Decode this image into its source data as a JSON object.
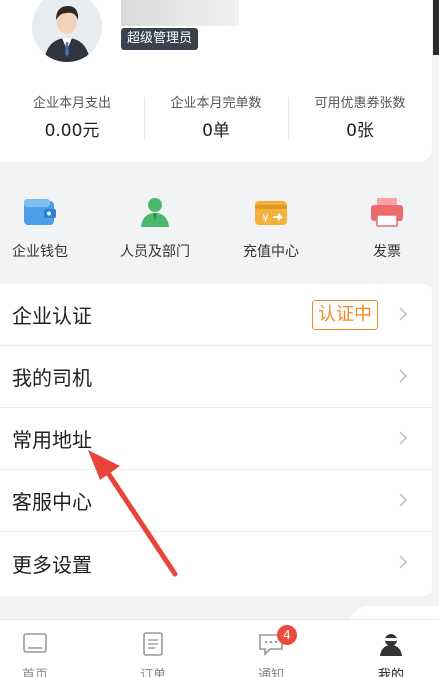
{
  "profile": {
    "role_badge": "超级管理员"
  },
  "stats": [
    {
      "label": "企业本月支出",
      "value": "0.00元"
    },
    {
      "label": "企业本月完单数",
      "value": "0单"
    },
    {
      "label": "可用优惠券张数",
      "value": "0张"
    }
  ],
  "quick_actions": [
    {
      "label": "企业钱包",
      "icon": "wallet-icon",
      "color": "#4a9fe8"
    },
    {
      "label": "人员及部门",
      "icon": "people-icon",
      "color": "#49b86a"
    },
    {
      "label": "充值中心",
      "icon": "recharge-icon",
      "color": "#f4b23c"
    },
    {
      "label": "发票",
      "icon": "printer-icon",
      "color": "#ee6b6b"
    }
  ],
  "menu": [
    {
      "label": "企业认证",
      "badge": "认证中"
    },
    {
      "label": "我的司机"
    },
    {
      "label": "常用地址"
    },
    {
      "label": "客服中心"
    },
    {
      "label": "更多设置"
    }
  ],
  "tabs": [
    {
      "label": "首页",
      "icon": "home-icon"
    },
    {
      "label": "订单",
      "icon": "order-icon"
    },
    {
      "label": "通知",
      "icon": "message-icon",
      "badge": "4"
    },
    {
      "label": "我的",
      "icon": "user-icon"
    }
  ],
  "colors": {
    "accent_orange": "#f08a24",
    "annotation_arrow": "#e8443a",
    "badge_red": "#e94c3d"
  }
}
